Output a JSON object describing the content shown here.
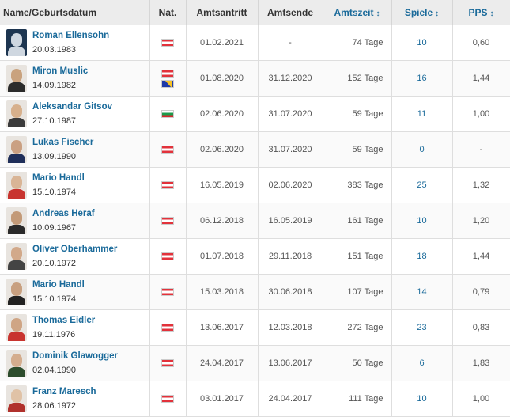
{
  "header": {
    "name": "Name/Geburtsdatum",
    "nat": "Nat.",
    "start": "Amtsantritt",
    "end": "Amtsende",
    "tenure": "Amtszeit",
    "games": "Spiele",
    "pps": "PPS",
    "sort_icon": "↕"
  },
  "colors": {
    "link": "#1a6a9a",
    "header_bg": "#ececec"
  },
  "rows": [
    {
      "name": "Roman Ellensohn",
      "birth": "20.03.1983",
      "flags": [
        "flag-austria"
      ],
      "start": "01.02.2021",
      "end": "-",
      "tenure": "74 Tage",
      "games": "10",
      "pps": "0,60",
      "photo": "placeholder-silhouette"
    },
    {
      "name": "Miron Muslic",
      "birth": "14.09.1982",
      "flags": [
        "flag-austria",
        "flag-bosnia"
      ],
      "start": "01.08.2020",
      "end": "31.12.2020",
      "tenure": "152 Tage",
      "games": "16",
      "pps": "1,44",
      "photo": "portrait"
    },
    {
      "name": "Aleksandar Gitsov",
      "birth": "27.10.1987",
      "flags": [
        "flag-bulgaria"
      ],
      "start": "02.06.2020",
      "end": "31.07.2020",
      "tenure": "59 Tage",
      "games": "11",
      "pps": "1,00",
      "photo": "portrait"
    },
    {
      "name": "Lukas Fischer",
      "birth": "13.09.1990",
      "flags": [
        "flag-austria"
      ],
      "start": "02.06.2020",
      "end": "31.07.2020",
      "tenure": "59 Tage",
      "games": "0",
      "pps": "-",
      "photo": "portrait"
    },
    {
      "name": "Mario Handl",
      "birth": "15.10.1974",
      "flags": [
        "flag-austria"
      ],
      "start": "16.05.2019",
      "end": "02.06.2020",
      "tenure": "383 Tage",
      "games": "25",
      "pps": "1,32",
      "photo": "portrait"
    },
    {
      "name": "Andreas Heraf",
      "birth": "10.09.1967",
      "flags": [
        "flag-austria"
      ],
      "start": "06.12.2018",
      "end": "16.05.2019",
      "tenure": "161 Tage",
      "games": "10",
      "pps": "1,20",
      "photo": "portrait"
    },
    {
      "name": "Oliver Oberhammer",
      "birth": "20.10.1972",
      "flags": [
        "flag-austria"
      ],
      "start": "01.07.2018",
      "end": "29.11.2018",
      "tenure": "151 Tage",
      "games": "18",
      "pps": "1,44",
      "photo": "portrait"
    },
    {
      "name": "Mario Handl",
      "birth": "15.10.1974",
      "flags": [
        "flag-austria"
      ],
      "start": "15.03.2018",
      "end": "30.06.2018",
      "tenure": "107 Tage",
      "games": "14",
      "pps": "0,79",
      "photo": "portrait"
    },
    {
      "name": "Thomas Eidler",
      "birth": "19.11.1976",
      "flags": [
        "flag-austria"
      ],
      "start": "13.06.2017",
      "end": "12.03.2018",
      "tenure": "272 Tage",
      "games": "23",
      "pps": "0,83",
      "photo": "portrait"
    },
    {
      "name": "Dominik Glawogger",
      "birth": "02.04.1990",
      "flags": [
        "flag-austria"
      ],
      "start": "24.04.2017",
      "end": "13.06.2017",
      "tenure": "50 Tage",
      "games": "6",
      "pps": "1,83",
      "photo": "portrait"
    },
    {
      "name": "Franz Maresch",
      "birth": "28.06.1972",
      "flags": [
        "flag-austria"
      ],
      "start": "03.01.2017",
      "end": "24.04.2017",
      "tenure": "111 Tage",
      "games": "10",
      "pps": "1,00",
      "photo": "portrait"
    }
  ]
}
